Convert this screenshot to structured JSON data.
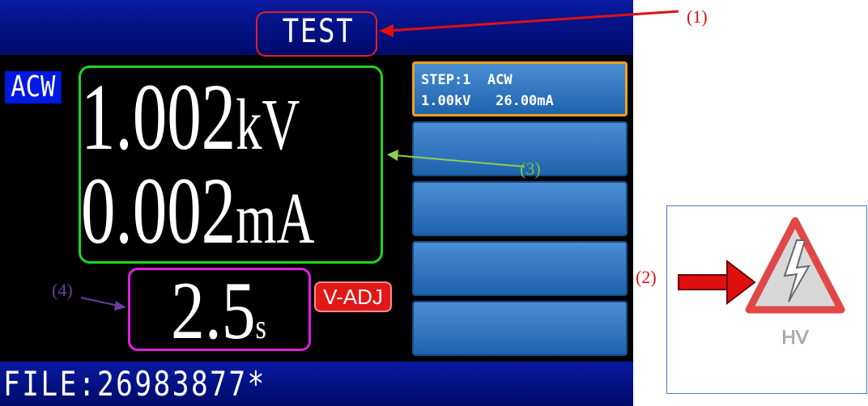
{
  "screen": {
    "title": "TEST",
    "mode": "ACW",
    "voltage": {
      "value": "1.002",
      "unit": "kV"
    },
    "current": {
      "value": "0.002",
      "unit": "mA"
    },
    "timer": {
      "value": "2.5",
      "unit": "s"
    },
    "adjust_badge": "V-ADJ",
    "file_label": "FILE:26983877*"
  },
  "steps": [
    {
      "line1": "STEP:1  ACW",
      "line2": "1.00kV   26.00mA",
      "active": true
    },
    {
      "line1": "",
      "line2": "",
      "active": false
    },
    {
      "line1": "",
      "line2": "",
      "active": false
    },
    {
      "line1": "",
      "line2": "",
      "active": false
    },
    {
      "line1": "",
      "line2": "",
      "active": false
    }
  ],
  "callouts": [
    "(1)",
    "(2)",
    "(3)",
    "(4)"
  ],
  "hv_icon": {
    "name": "high-voltage-warning-icon",
    "label": "HV"
  },
  "colors": {
    "title_ring": "#e02020",
    "readings_ring": "#1ed51e",
    "timer_ring": "#e01ee0",
    "active_step_border": "#f3a11e",
    "badge": "#e01818"
  }
}
